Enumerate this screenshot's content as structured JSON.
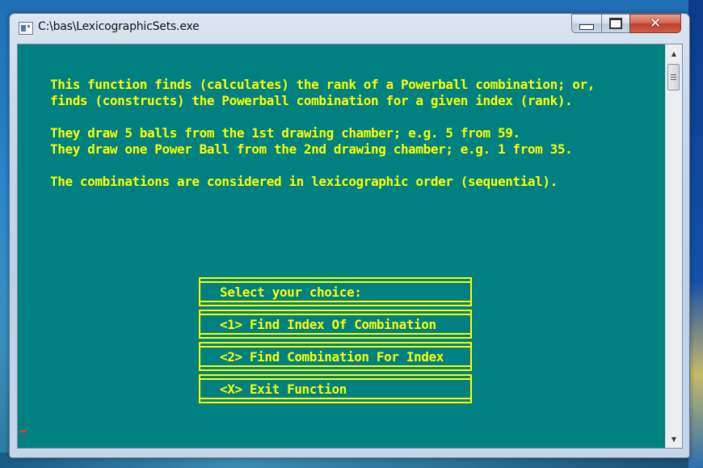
{
  "window": {
    "title": "C:\\bas\\LexicographicSets.exe",
    "controls": {
      "minimize": "minimize",
      "maximize": "maximize",
      "close": "✕"
    }
  },
  "console": {
    "colors": {
      "background": "#008080",
      "text": "#ffff00",
      "cursor": "#d04040"
    },
    "lines": [
      "This function finds (calculates) the rank of a Powerball combination; or,",
      "finds (constructs) the Powerball combination for a given index (rank).",
      "",
      "They draw 5 balls from the 1st drawing chamber; e.g. 5 from 59.",
      "They draw one Power Ball from the 2nd drawing chamber; e.g. 1 from 35.",
      "",
      "The combinations are considered in lexicographic order (sequential)."
    ],
    "menu": {
      "header": "Select your choice:",
      "options": [
        {
          "key": "1",
          "label": "<1> Find Index Of Combination"
        },
        {
          "key": "2",
          "label": "<2> Find Combination For Index"
        },
        {
          "key": "X",
          "label": "<X> Exit Function"
        }
      ]
    }
  },
  "scrollbar": {
    "up_arrow": "▲",
    "down_arrow": "▼"
  }
}
